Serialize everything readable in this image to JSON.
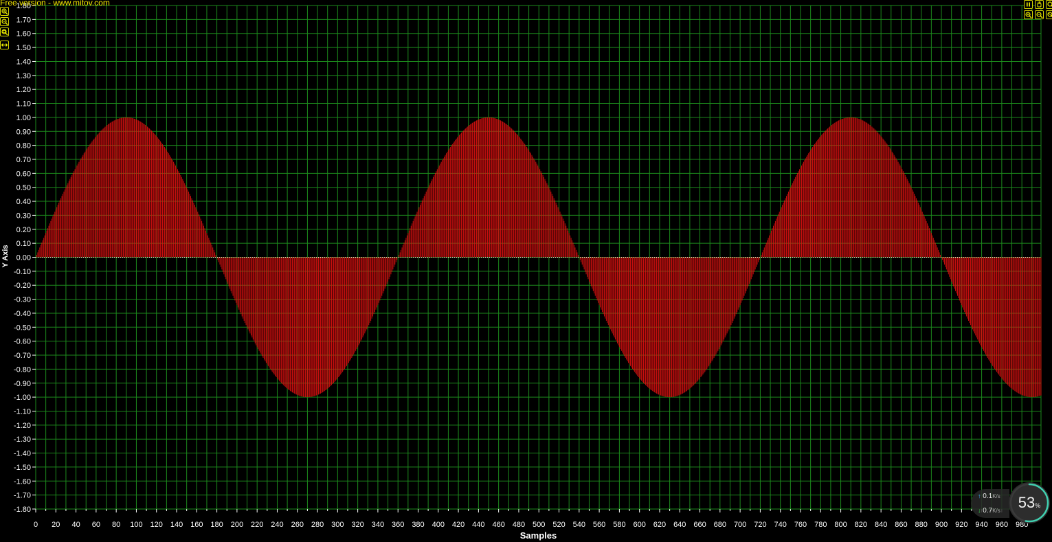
{
  "watermark": "Free version - www.mitov.com",
  "chart_data": {
    "type": "bar",
    "title": "",
    "xlabel": "Samples",
    "ylabel": "Y Axis",
    "xlim": [
      0,
      999
    ],
    "ylim": [
      -1.8,
      1.8
    ],
    "x_ticks": [
      0,
      20,
      40,
      60,
      80,
      100,
      120,
      140,
      160,
      180,
      200,
      220,
      240,
      260,
      280,
      300,
      320,
      340,
      360,
      380,
      400,
      420,
      440,
      460,
      480,
      500,
      520,
      540,
      560,
      580,
      600,
      620,
      640,
      660,
      680,
      700,
      720,
      740,
      760,
      780,
      800,
      820,
      840,
      860,
      880,
      900,
      920,
      940,
      960,
      980
    ],
    "y_ticks": [
      1.8,
      1.7,
      1.6,
      1.5,
      1.4,
      1.3,
      1.2,
      1.1,
      1.0,
      0.9,
      0.8,
      0.7,
      0.6,
      0.5,
      0.4,
      0.3,
      0.2,
      0.1,
      0.0,
      -0.1,
      -0.2,
      -0.3,
      -0.4,
      -0.5,
      -0.6,
      -0.7,
      -0.8,
      -0.9,
      -1.0,
      -1.1,
      -1.2,
      -1.3,
      -1.4,
      -1.5,
      -1.6,
      -1.7,
      -1.8
    ],
    "grid": true,
    "series": [
      {
        "function": "sin",
        "amplitude": 1.0,
        "period_samples": 360,
        "phase_deg": 0,
        "sample_step": 1,
        "sample_range": [
          0,
          999
        ],
        "color": "#e01010"
      }
    ]
  },
  "colors": {
    "background": "#000000",
    "grid": "#1c8a1c",
    "bars": "#e01010",
    "tick_text": "#ffffff",
    "watermark": "#f5e800",
    "toolbar": "#f0f000"
  },
  "toolbar_left": [
    {
      "icon": "zoom-in-icon"
    },
    {
      "icon": "zoom-out-icon"
    },
    {
      "icon": "zoom-fit-icon"
    },
    {
      "icon": "pan-horizontal-icon"
    }
  ],
  "toolbar_right": [
    {
      "icon": "pause-icon"
    },
    {
      "icon": "hand-icon"
    },
    {
      "icon": "zoom-in-icon"
    },
    {
      "icon": "zoom-out-icon"
    },
    {
      "icon": "zoom-reset-icon"
    }
  ],
  "network_widget": {
    "upload_value": "0.1",
    "upload_unit": "K/s",
    "download_value": "0.7",
    "download_unit": "K/s",
    "cpu_value": "53",
    "cpu_percent": 53,
    "cpu_unit": "%"
  }
}
